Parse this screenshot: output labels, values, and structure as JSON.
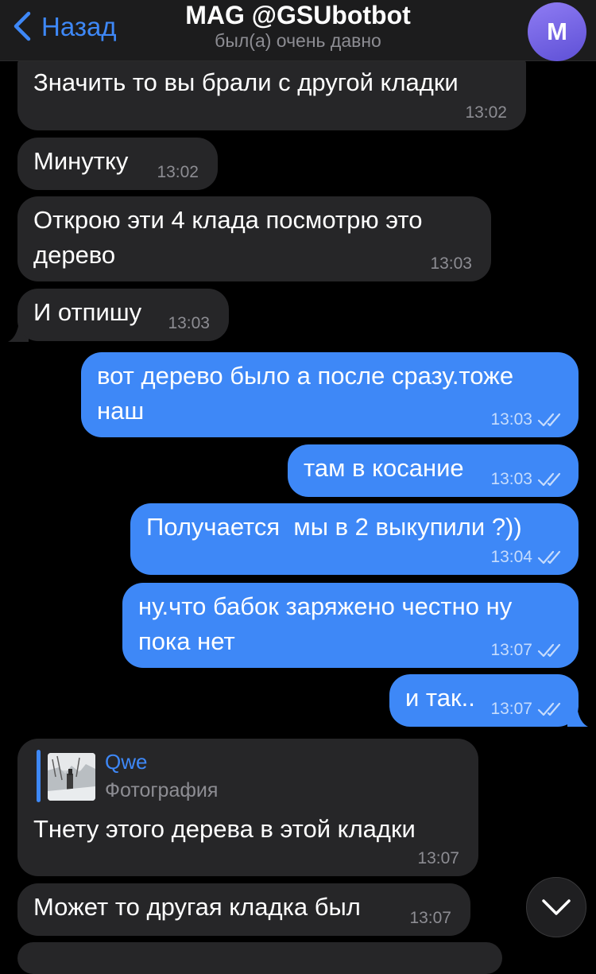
{
  "header": {
    "back_label": "Назад",
    "title": "MAG @GSUbotbot",
    "status": "был(а) очень давно",
    "avatar_letter": "M"
  },
  "messages": [
    {
      "direction": "in",
      "text": "Значить то вы брали с другой кладки",
      "time": "13:02"
    },
    {
      "direction": "in",
      "text": "Минутку",
      "time": "13:02"
    },
    {
      "direction": "in",
      "text": "Открою эти 4 клада посмотрю это дерево",
      "time": "13:03"
    },
    {
      "direction": "in",
      "text": "И отпишу",
      "time": "13:03"
    },
    {
      "direction": "out",
      "text": "вот дерево было а после сразу.тоже наш",
      "time": "13:03",
      "read": true
    },
    {
      "direction": "out",
      "text": "там в косание",
      "time": "13:03",
      "read": true
    },
    {
      "direction": "out",
      "text": "Получается  мы в 2 выкупили ?))",
      "time": "13:04",
      "read": true
    },
    {
      "direction": "out",
      "text": "ну.что бабок заряжено честно ну пока нет",
      "time": "13:07",
      "read": true
    },
    {
      "direction": "out",
      "text": "и так..",
      "time": "13:07",
      "read": true
    },
    {
      "direction": "in",
      "reply_to": {
        "name": "Qwe",
        "text": "Фотография"
      },
      "text": "Тнету этого дерева в этой кладки",
      "time": "13:07"
    },
    {
      "direction": "in",
      "text": "Может то другая кладка был",
      "time": "13:07"
    }
  ],
  "colors": {
    "background": "#000000",
    "incoming_bubble": "#262628",
    "outgoing_bubble": "#3e88f7",
    "accent": "#3e88f7",
    "secondary_text": "#8d8d93"
  },
  "icons": {
    "back": "chevron-left-icon",
    "read_status": "double-check-icon",
    "scroll_down": "chevron-down-icon"
  }
}
